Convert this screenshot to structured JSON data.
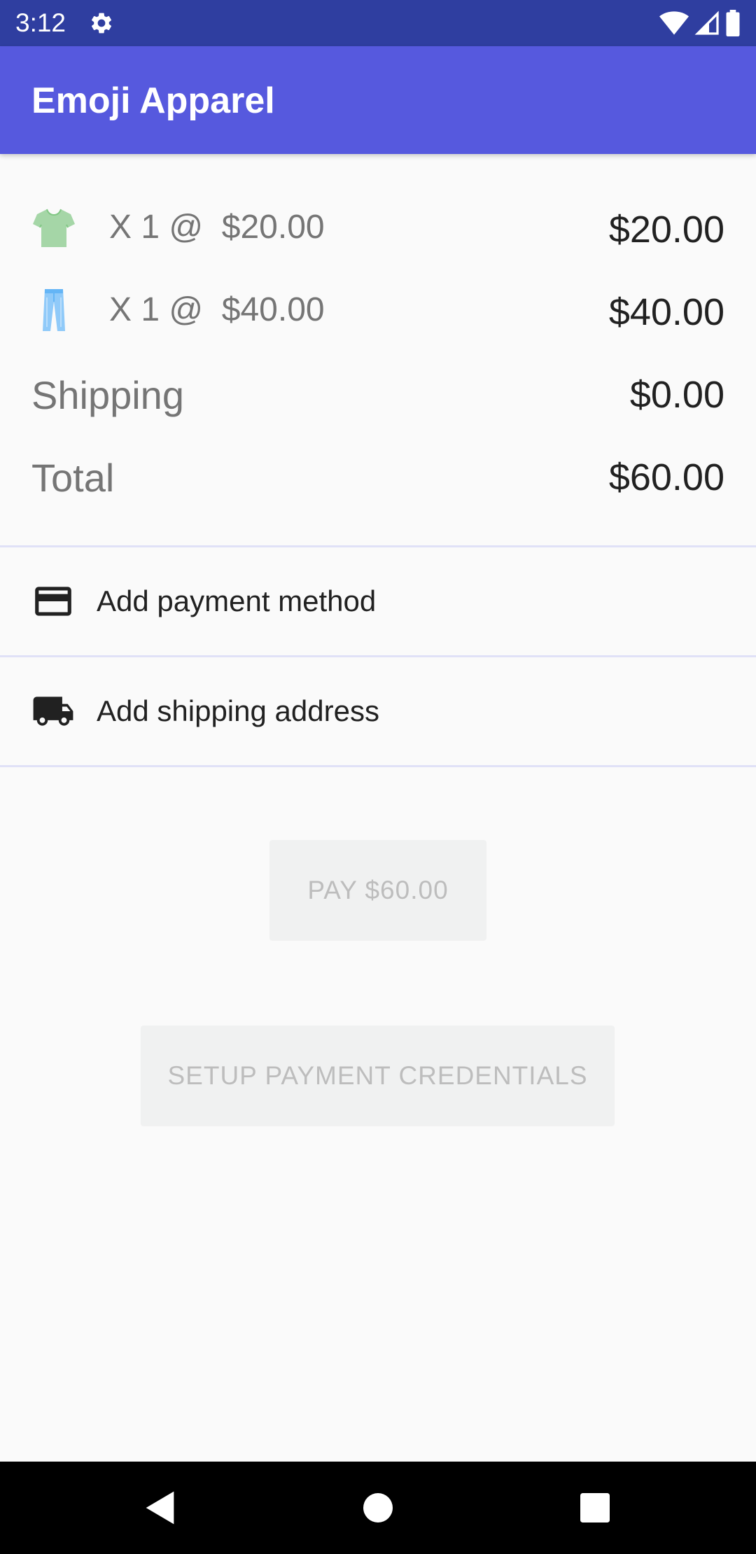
{
  "status_bar": {
    "time": "3:12",
    "left_icon": "gear-icon",
    "right_icons": [
      "wifi-icon",
      "cell-signal-icon",
      "battery-icon"
    ]
  },
  "app_bar": {
    "title": "Emoji Apparel"
  },
  "order": {
    "items": [
      {
        "icon": "tshirt-emoji",
        "quantity_text": "X 1 @  $20.00",
        "line_total": "$20.00"
      },
      {
        "icon": "jeans-emoji",
        "quantity_text": "X 1 @  $40.00",
        "line_total": "$40.00"
      }
    ],
    "shipping": {
      "label": "Shipping",
      "amount": "$0.00"
    },
    "total": {
      "label": "Total",
      "amount": "$60.00"
    }
  },
  "actions": {
    "payment": {
      "icon": "credit-card-icon",
      "label": "Add payment method"
    },
    "shipping": {
      "icon": "truck-icon",
      "label": "Add shipping address"
    }
  },
  "buttons": {
    "pay_label": "PAY $60.00",
    "setup_label": "SETUP PAYMENT CREDENTIALS"
  },
  "nav_bar": {
    "icons": [
      "back-icon",
      "home-icon",
      "recents-icon"
    ]
  },
  "colors": {
    "status_bar": "#2f3ea0",
    "app_bar": "#5659de",
    "background": "#fafafa",
    "disabled_button": "#f0f1f1",
    "disabled_text": "#bdbdbd"
  }
}
